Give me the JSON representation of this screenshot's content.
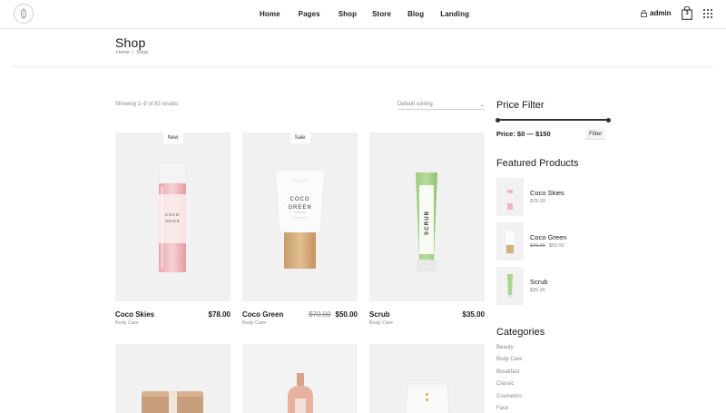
{
  "header": {
    "nav": [
      "Home",
      "Pages",
      "Shop",
      "Store",
      "Blog",
      "Landing"
    ],
    "user": "admin",
    "cart_count": "3"
  },
  "page": {
    "title": "Shop",
    "breadcrumb": [
      "Home",
      "\\",
      "Shop"
    ]
  },
  "toolbar": {
    "results": "Showing 1–9 of 83 results",
    "sorting": "Default sorting"
  },
  "products": [
    {
      "name": "Coco Skies",
      "category": "Body Care",
      "price": "$78.00",
      "old_price": "",
      "badge": "New"
    },
    {
      "name": "Coco Green",
      "category": "Body Care",
      "price": "$50.00",
      "old_price": "$70.00",
      "badge": "Sale"
    },
    {
      "name": "Scrub",
      "category": "Body Care",
      "price": "$35.00",
      "old_price": "",
      "badge": ""
    }
  ],
  "sidebar": {
    "price_filter_title": "Price Filter",
    "price_range": "Price: $0 — $150",
    "filter_button": "Filter",
    "featured_title": "Featured Products",
    "featured": [
      {
        "name": "Coco Skies",
        "price": "$78.00",
        "old_price": ""
      },
      {
        "name": "Coco Green",
        "price": "$50.00",
        "old_price": "$70.00"
      },
      {
        "name": "Scrub",
        "price": "$35.00",
        "old_price": ""
      }
    ],
    "categories_title": "Categories",
    "categories": [
      "Beauty",
      "Body Care",
      "Breakfast",
      "Classic",
      "Cosmetics",
      "Face"
    ]
  },
  "product_labels": {
    "coco_skies": [
      "COCO",
      "SKIES"
    ],
    "coco_green": [
      "COCO",
      "GREEN"
    ],
    "scrub": "SCRUB"
  },
  "colors": {
    "accent": "#1a1a1a",
    "muted": "#888888",
    "card_bg": "#f1f1f1"
  }
}
